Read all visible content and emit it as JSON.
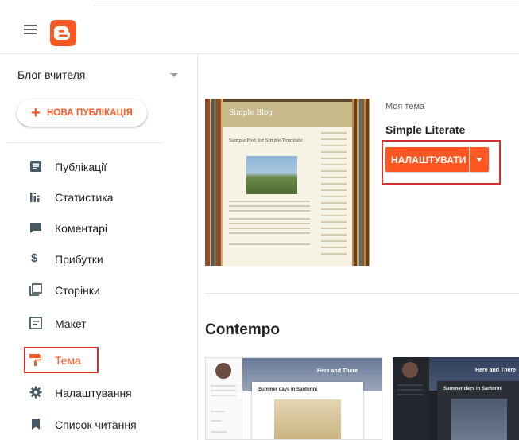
{
  "header": {
    "menu_icon": "hamburger-menu-icon",
    "logo_icon": "blogger-logo-icon",
    "brand_color": "#ff5722"
  },
  "sidebar": {
    "blog_name": "Блог вчителя",
    "new_post_label": "НОВА ПУБЛІКАЦІЯ",
    "items": [
      {
        "label": "Публікації",
        "icon": "posts-icon"
      },
      {
        "label": "Статистика",
        "icon": "stats-icon"
      },
      {
        "label": "Коментарі",
        "icon": "comments-icon"
      },
      {
        "label": "Прибутки",
        "icon": "dollar-icon"
      },
      {
        "label": "Сторінки",
        "icon": "pages-icon"
      },
      {
        "label": "Макет",
        "icon": "layout-icon"
      },
      {
        "label": "Тема",
        "icon": "theme-paint-roller-icon",
        "active": true
      },
      {
        "label": "Налаштування",
        "icon": "settings-gear-icon"
      },
      {
        "label": "Список читання",
        "icon": "bookmark-icon"
      }
    ]
  },
  "main": {
    "current_theme": {
      "section_label": "Моя тема",
      "name": "Simple Literate",
      "preview_title": "Simple Blog",
      "preview_post_title": "Sample Post for Simple Template"
    },
    "customize_label": "НАЛАШТУВАТИ",
    "dropdown_icon": "arrow-drop-down-icon",
    "gallery_section": "Contempo",
    "cards": [
      {
        "hero_title": "Here and There",
        "post_title": "Summer days in Santorini"
      },
      {
        "hero_title": "Here and There",
        "post_title": "Summer days in Santorini"
      }
    ]
  },
  "colors": {
    "accent": "#ff5722",
    "highlight_box": "#d32f2f",
    "text": "#212121"
  }
}
